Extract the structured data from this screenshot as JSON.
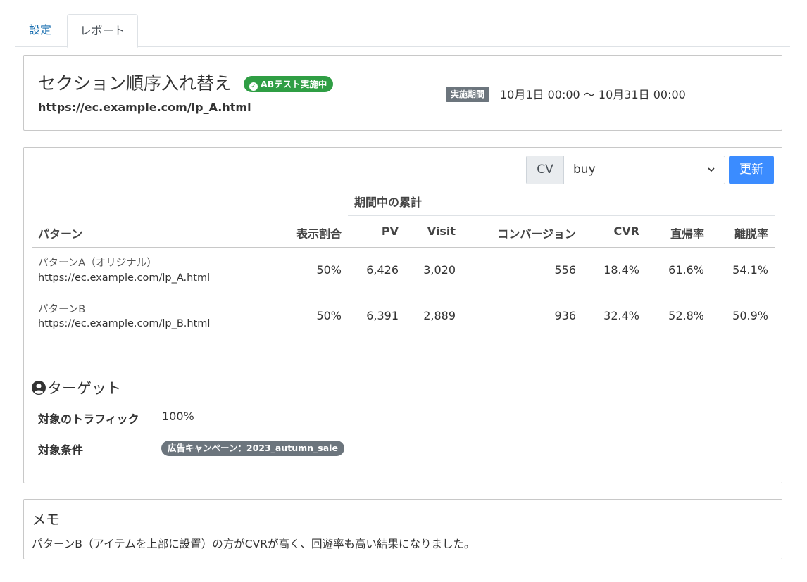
{
  "tabs": [
    {
      "label": "設定"
    },
    {
      "label": "レポート"
    }
  ],
  "header": {
    "title": "セクション順序入れ替え",
    "status_badge": "ABテスト実施中",
    "url": "https://ec.example.com/lp_A.html",
    "period_label": "実施期間",
    "period_value": "10月1日 00:00 〜 10月31日 00:00"
  },
  "controls": {
    "cv_label": "CV",
    "cv_selected": "buy",
    "update_label": "更新"
  },
  "table": {
    "group_header": "期間中の累計",
    "columns": [
      "パターン",
      "表示割合",
      "PV",
      "Visit",
      "コンバージョン",
      "CVR",
      "直帰率",
      "離脱率"
    ],
    "rows": [
      {
        "name": "パターンA（オリジナル）",
        "url": "https://ec.example.com/lp_A.html",
        "ratio": "50%",
        "pv": "6,426",
        "visit": "3,020",
        "cv": "556",
        "cvr": "18.4%",
        "bounce": "61.6%",
        "exit": "54.1%"
      },
      {
        "name": "パターンB",
        "url": "https://ec.example.com/lp_B.html",
        "ratio": "50%",
        "pv": "6,391",
        "visit": "2,889",
        "cv": "936",
        "cvr": "32.4%",
        "bounce": "52.8%",
        "exit": "50.9%"
      }
    ]
  },
  "target": {
    "title": "ターゲット",
    "traffic_label": "対象のトラフィック",
    "traffic_value": "100%",
    "condition_label": "対象条件",
    "condition_value": "広告キャンペーン：2023_autumn_sale"
  },
  "memo": {
    "title": "メモ",
    "text": "パターンB（アイテムを上部に設置）の方がCVRが高く、回遊率も高い結果になりました。"
  },
  "colors": {
    "accent": "#3b8cff",
    "success_badge": "#2f9e44",
    "secondary_badge": "#6c757d"
  },
  "icons": [
    "check-circle-icon",
    "chevron-down-icon",
    "user-circle-icon"
  ]
}
